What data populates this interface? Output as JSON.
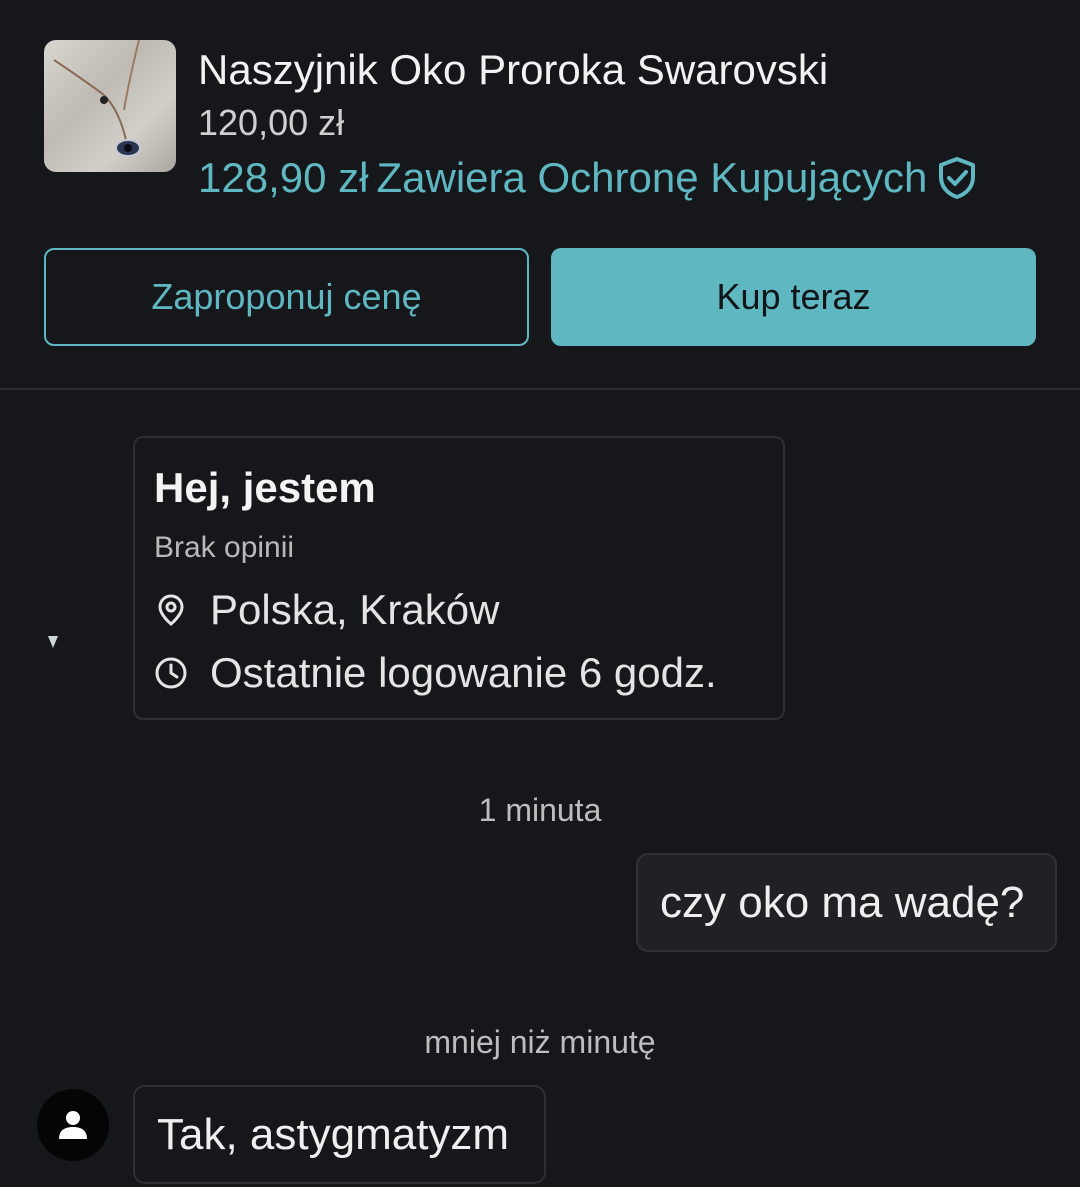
{
  "product": {
    "title": "Naszyjnik Oko Proroka Swarovski",
    "price": "120,00 zł",
    "total_price": "128,90 zł",
    "protection_label": "Zawiera Ochronę Kupujących",
    "thumbnail_icon": "necklace-photo",
    "shield_icon": "shield-check-icon"
  },
  "actions": {
    "offer_label": "Zaproponuj cenę",
    "buy_label": "Kup teraz"
  },
  "seller": {
    "greeting": "Hej, jestem",
    "rating": "Brak opinii",
    "location": "Polska, Kraków",
    "last_login": "Ostatnie logowanie 6 godz."
  },
  "chat": {
    "messages": [
      {
        "timestamp": "1 minuta",
        "text": "czy oko ma wadę?",
        "direction": "outgoing"
      },
      {
        "timestamp": "mniej niż minutę",
        "text": "Tak, astygmatyzm",
        "direction": "incoming"
      }
    ]
  },
  "colors": {
    "accent": "#5fb8c1",
    "background": "#16171b"
  }
}
